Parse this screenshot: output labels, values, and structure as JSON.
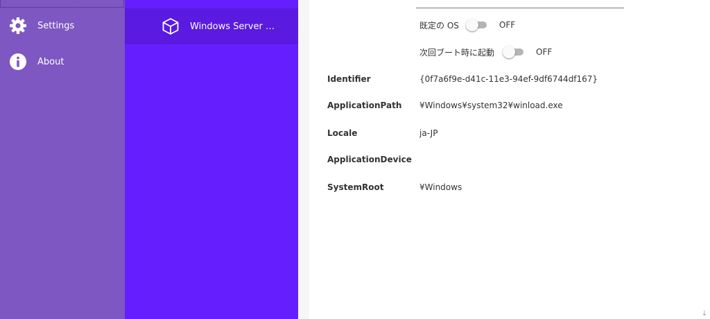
{
  "nav": {
    "items": [
      {
        "label": "Settings",
        "icon": "gear-icon"
      },
      {
        "label": "About",
        "icon": "info-icon"
      }
    ]
  },
  "list": {
    "items": [
      {
        "label": "Windows Server 20…",
        "icon": "cube-icon"
      }
    ]
  },
  "details": {
    "toggles": [
      {
        "label": "既定の OS",
        "state": "OFF"
      },
      {
        "label": "次回ブート時に起動",
        "state": "OFF"
      }
    ],
    "properties": [
      {
        "name": "Identifier",
        "value": "{0f7a6f9e-d41c-11e3-94ef-9df6744df167}"
      },
      {
        "name": "ApplicationPath",
        "value": "¥Windows¥system32¥winload.exe"
      },
      {
        "name": "Locale",
        "value": "ja-JP"
      },
      {
        "name": "ApplicationDevice",
        "value": ""
      },
      {
        "name": "SystemRoot",
        "value": "¥Windows"
      }
    ]
  },
  "colors": {
    "nav_background": "#7e57c2",
    "list_background": "#651fff",
    "list_selected": "#5a1ae0"
  }
}
